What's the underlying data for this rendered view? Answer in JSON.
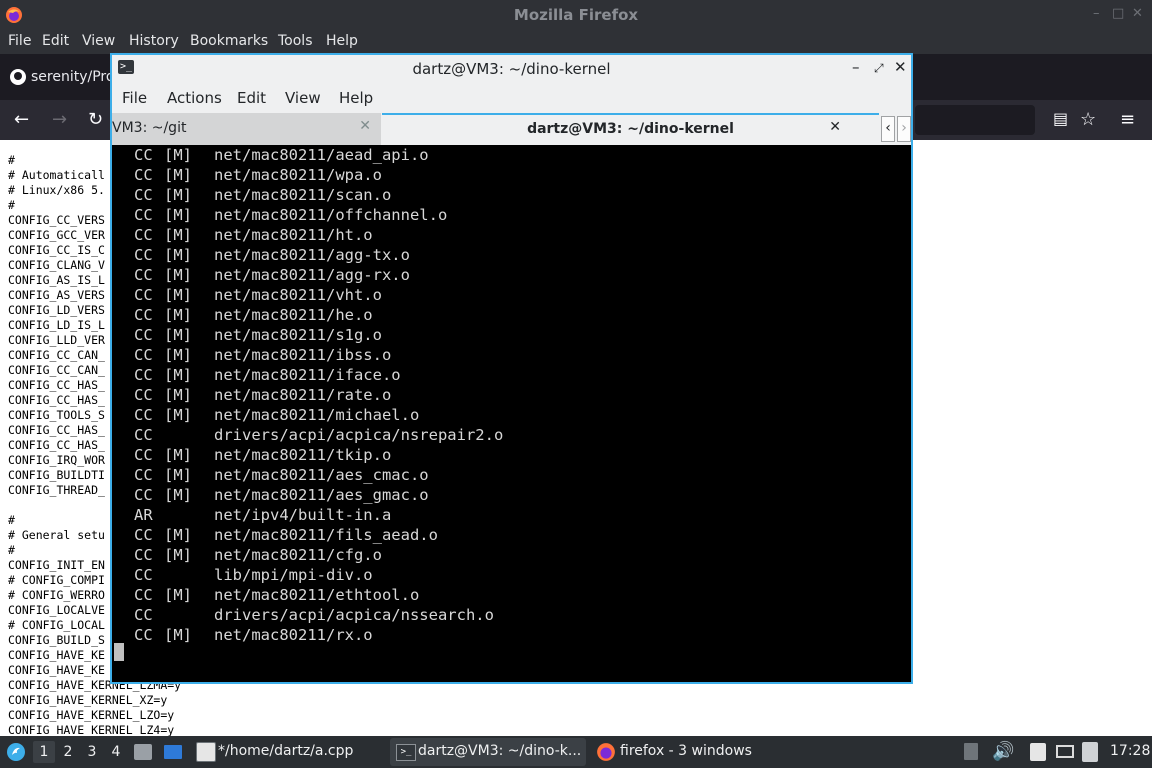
{
  "firefox": {
    "window_title": "Mozilla Firefox",
    "window_buttons": [
      "–",
      "□",
      "✕"
    ],
    "menu": [
      "File",
      "Edit",
      "View",
      "History",
      "Bookmarks",
      "Tools",
      "Help"
    ],
    "tab_label": "serenity/Pro",
    "content_lines": [
      "#",
      "# Automaticall",
      "# Linux/x86 5.",
      "#",
      "CONFIG_CC_VERS",
      "CONFIG_GCC_VER",
      "CONFIG_CC_IS_C",
      "CONFIG_CLANG_V",
      "CONFIG_AS_IS_L",
      "CONFIG_AS_VERS",
      "CONFIG_LD_VERS",
      "CONFIG_LD_IS_L",
      "CONFIG_LLD_VER",
      "CONFIG_CC_CAN_",
      "CONFIG_CC_CAN_",
      "CONFIG_CC_HAS_",
      "CONFIG_CC_HAS_",
      "CONFIG_TOOLS_S",
      "CONFIG_CC_HAS_",
      "CONFIG_CC_HAS_",
      "CONFIG_IRQ_WOR",
      "CONFIG_BUILDTI",
      "CONFIG_THREAD_",
      "",
      "#",
      "# General setu",
      "#",
      "CONFIG_INIT_EN",
      "# CONFIG_COMPI",
      "# CONFIG_WERRO",
      "CONFIG_LOCALVE",
      "# CONFIG_LOCAL",
      "CONFIG_BUILD_S",
      "CONFIG_HAVE_KE",
      "CONFIG_HAVE_KE",
      "CONFIG_HAVE_KERNEL_LZMA=y",
      "CONFIG_HAVE_KERNEL_XZ=y",
      "CONFIG_HAVE_KERNEL_LZO=y",
      "CONFIG_HAVE_KERNEL_LZ4=y"
    ]
  },
  "terminal": {
    "window_title": "dartz@VM3: ~/dino-kernel",
    "menu": [
      "File",
      "Actions",
      "Edit",
      "View",
      "Help"
    ],
    "tabs": [
      {
        "label": "VM3: ~/git"
      },
      {
        "label": "dartz@VM3: ~/dino-kernel"
      }
    ],
    "lines": [
      {
        "a": "CC",
        "b": "[M]",
        "c": "net/mac80211/aead_api.o"
      },
      {
        "a": "CC",
        "b": "[M]",
        "c": "net/mac80211/wpa.o"
      },
      {
        "a": "CC",
        "b": "[M]",
        "c": "net/mac80211/scan.o"
      },
      {
        "a": "CC",
        "b": "[M]",
        "c": "net/mac80211/offchannel.o"
      },
      {
        "a": "CC",
        "b": "[M]",
        "c": "net/mac80211/ht.o"
      },
      {
        "a": "CC",
        "b": "[M]",
        "c": "net/mac80211/agg-tx.o"
      },
      {
        "a": "CC",
        "b": "[M]",
        "c": "net/mac80211/agg-rx.o"
      },
      {
        "a": "CC",
        "b": "[M]",
        "c": "net/mac80211/vht.o"
      },
      {
        "a": "CC",
        "b": "[M]",
        "c": "net/mac80211/he.o"
      },
      {
        "a": "CC",
        "b": "[M]",
        "c": "net/mac80211/s1g.o"
      },
      {
        "a": "CC",
        "b": "[M]",
        "c": "net/mac80211/ibss.o"
      },
      {
        "a": "CC",
        "b": "[M]",
        "c": "net/mac80211/iface.o"
      },
      {
        "a": "CC",
        "b": "[M]",
        "c": "net/mac80211/rate.o"
      },
      {
        "a": "CC",
        "b": "[M]",
        "c": "net/mac80211/michael.o"
      },
      {
        "a": "CC",
        "b": "",
        "c": "drivers/acpi/acpica/nsrepair2.o"
      },
      {
        "a": "CC",
        "b": "[M]",
        "c": "net/mac80211/tkip.o"
      },
      {
        "a": "CC",
        "b": "[M]",
        "c": "net/mac80211/aes_cmac.o"
      },
      {
        "a": "CC",
        "b": "[M]",
        "c": "net/mac80211/aes_gmac.o"
      },
      {
        "a": "AR",
        "b": "",
        "c": "net/ipv4/built-in.a"
      },
      {
        "a": "CC",
        "b": "[M]",
        "c": "net/mac80211/fils_aead.o"
      },
      {
        "a": "CC",
        "b": "[M]",
        "c": "net/mac80211/cfg.o"
      },
      {
        "a": "CC",
        "b": "",
        "c": "lib/mpi/mpi-div.o"
      },
      {
        "a": "CC",
        "b": "[M]",
        "c": "net/mac80211/ethtool.o"
      },
      {
        "a": "CC",
        "b": "",
        "c": "drivers/acpi/acpica/nssearch.o"
      },
      {
        "a": "CC",
        "b": "[M]",
        "c": "net/mac80211/rx.o"
      }
    ]
  },
  "taskbar": {
    "workspaces": [
      "1",
      "2",
      "3",
      "4"
    ],
    "tasks": [
      {
        "label": "*/home/dartz/a.cpp"
      },
      {
        "label": "dartz@VM3: ~/dino-k..."
      },
      {
        "label": "firefox - 3 windows"
      }
    ],
    "clock": "17:28"
  },
  "colors": {
    "accent": "#3daee9",
    "terminal_bg": "#000000",
    "terminal_fg": "#d8d8d8",
    "taskbar_bg": "#2a2e32"
  }
}
